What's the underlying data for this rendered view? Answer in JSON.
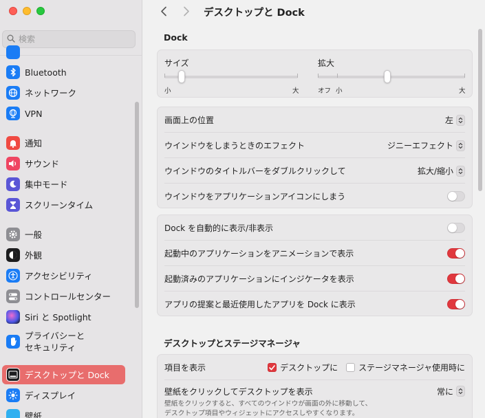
{
  "window": {
    "title": "デスクトップと Dock"
  },
  "search": {
    "placeholder": "検索"
  },
  "colors": {
    "accent": "#e0383e",
    "active_sidebar": "#e86d6d"
  },
  "sidebar": {
    "items": [
      {
        "label": "Bluetooth",
        "icon": "bluetooth-icon",
        "color": "#1a7cf5"
      },
      {
        "label": "ネットワーク",
        "icon": "globe-icon",
        "color": "#1a7cf5"
      },
      {
        "label": "VPN",
        "icon": "vpn-globe-icon",
        "color": "#1a7cf5"
      },
      {
        "label": "通知",
        "icon": "bell-icon",
        "color": "#f04a42"
      },
      {
        "label": "サウンド",
        "icon": "speaker-icon",
        "color": "#ef4562"
      },
      {
        "label": "集中モード",
        "icon": "moon-icon",
        "color": "#5a56d6"
      },
      {
        "label": "スクリーンタイム",
        "icon": "hourglass-icon",
        "color": "#5a56d6"
      },
      {
        "label": "一般",
        "icon": "gear-icon",
        "color": "#8e8e93"
      },
      {
        "label": "外観",
        "icon": "appearance-icon",
        "color": "#1c1c1e"
      },
      {
        "label": "アクセシビリティ",
        "icon": "accessibility-icon",
        "color": "#1a7cf5"
      },
      {
        "label": "コントロールセンター",
        "icon": "toggles-icon",
        "color": "#8e8e93"
      },
      {
        "label": "Siri と Spotlight",
        "icon": "siri-icon",
        "color": "#2c2c3e"
      },
      {
        "label": "プライバシーと\nセキュリティ",
        "icon": "hand-icon",
        "color": "#1a7cf5"
      },
      {
        "label": "デスクトップと Dock",
        "icon": "dock-icon",
        "color": "#1c1c1e"
      },
      {
        "label": "ディスプレイ",
        "icon": "sun-icon",
        "color": "#1a7cf5"
      },
      {
        "label": "壁紙",
        "icon": "wallpaper-icon",
        "color": "#30b0f0"
      }
    ]
  },
  "dock": {
    "section_title": "Dock",
    "size": {
      "label": "サイズ",
      "min_label": "小",
      "max_label": "大",
      "value": 0.11
    },
    "magnify": {
      "label": "拡大",
      "off_label": "オフ",
      "min_label": "小",
      "max_label": "大",
      "value": 0.47
    },
    "position": {
      "label": "画面上の位置",
      "value": "左"
    },
    "minimize_effect": {
      "label": "ウインドウをしまうときのエフェクト",
      "value": "ジニーエフェクト"
    },
    "titlebar_dblclick": {
      "label": "ウインドウのタイトルバーをダブルクリックして",
      "value": "拡大/縮小"
    },
    "minimize_into_icon": {
      "label": "ウインドウをアプリケーションアイコンにしまう",
      "on": false
    },
    "autohide": {
      "label": "Dock を自動的に表示/非表示",
      "on": false
    },
    "animate_opening": {
      "label": "起動中のアプリケーションをアニメーションで表示",
      "on": true
    },
    "show_indicators": {
      "label": "起動済みのアプリケーションにインジケータを表示",
      "on": true
    },
    "show_recents": {
      "label": "アプリの提案と最近使用したアプリを Dock に表示",
      "on": true
    }
  },
  "desktop_stage": {
    "section_title": "デスクトップとステージマネージャ",
    "show_items": {
      "label": "項目を表示",
      "desktop": {
        "label": "デスクトップに",
        "checked": true
      },
      "stage_manager": {
        "label": "ステージマネージャ使用時に",
        "checked": false
      }
    },
    "click_wallpaper": {
      "label": "壁紙をクリックしてデスクトップを表示",
      "value": "常に",
      "description_line1": "壁紙をクリックすると、すべてのウインドウが画面の外に移動して、",
      "description_line2": "デスクトップ項目やウィジェットにアクセスしやすくなります。"
    }
  }
}
